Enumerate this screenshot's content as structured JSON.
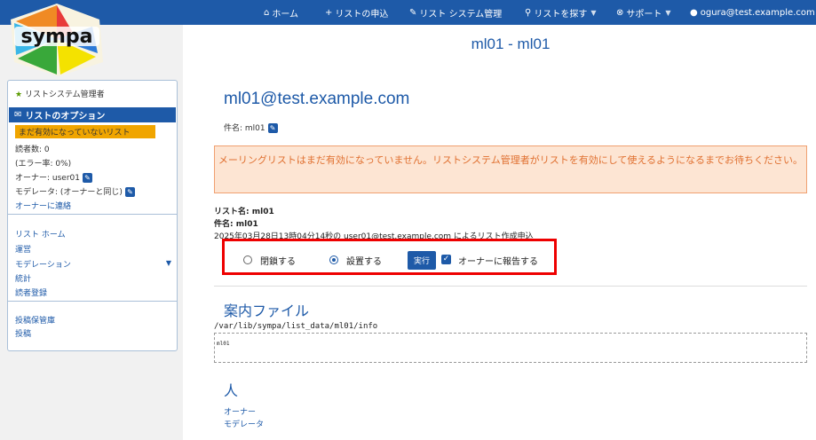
{
  "nav": {
    "home": "ホーム",
    "list_request": "リストの申込",
    "listmaster": "リスト システム管理",
    "search": "リストを探す",
    "support": "サポート",
    "user": "ogura@test.example.com"
  },
  "logo_text": "sympa",
  "sidebar": {
    "role": "リストシステム管理者",
    "options_title": "リストのオプション",
    "not_active": "まだ有効になっていないリスト",
    "subscribers": "読者数: 0",
    "error_rate": "(エラー率: 0%)",
    "owner": "オーナー: user01",
    "moderator": "モデレータ: (オーナーと同じ)",
    "contact_owner": "オーナーに連絡",
    "list_home": "リスト ホーム",
    "admin": "運営",
    "moderation": "モデレーション",
    "stats": "統計",
    "subscriber_list": "読者登録",
    "archive": "投稿保管庫",
    "post": "投稿"
  },
  "main": {
    "title": "ml01 - ml01",
    "address": "ml01@test.example.com",
    "subject_line": "件名: ml01",
    "warning": "メーリングリストはまだ有効になっていません。リストシステム管理者がリストを有効にして使えるようになるまでお待ちください。",
    "list_name": "リスト名: ml01",
    "subject_bold": "件名: ml01",
    "created": "2025年03月28日13時04分14秒の user01@test.example.com によるリスト作成申込",
    "close_label": "閉鎖する",
    "install_label": "設置する",
    "exec_button": "実行",
    "notify_owner": "オーナーに報告する",
    "info_title": "案内ファイル",
    "info_path": "/var/lib/sympa/list_data/ml01/info",
    "info_content": "ml01",
    "people_title": "人",
    "people_owner": "オーナー",
    "people_moderator": "モデレータ"
  }
}
